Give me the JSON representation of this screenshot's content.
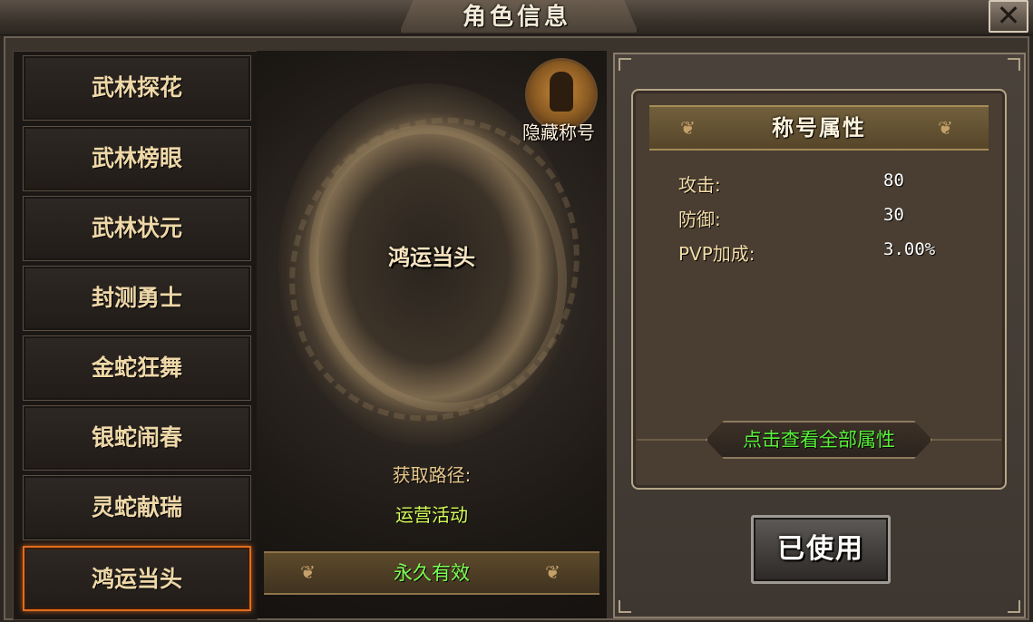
{
  "window": {
    "title": "角色信息",
    "close_glyph": "✕"
  },
  "title_list": {
    "items": [
      {
        "label": "武林探花",
        "selected": false
      },
      {
        "label": "武林榜眼",
        "selected": false
      },
      {
        "label": "武林状元",
        "selected": false
      },
      {
        "label": "封测勇士",
        "selected": false
      },
      {
        "label": "金蛇狂舞",
        "selected": false
      },
      {
        "label": "银蛇闹春",
        "selected": false
      },
      {
        "label": "灵蛇献瑞",
        "selected": false
      },
      {
        "label": "鸿运当头",
        "selected": true
      }
    ]
  },
  "preview": {
    "title_name": "鸿运当头",
    "hidden_title_label": "隐藏称号",
    "source_label": "获取路径:",
    "source_value": "运营活动",
    "validity": "永久有效"
  },
  "attributes": {
    "header": "称号属性",
    "rows": [
      {
        "name": "攻击:",
        "value": "80"
      },
      {
        "name": "防御:",
        "value": "30"
      },
      {
        "name": "PVP加成:",
        "value": "3.00%"
      }
    ],
    "view_all_label": "点击查看全部属性"
  },
  "actions": {
    "used_label": "已使用"
  },
  "colors": {
    "selected_border": "#e06d1e",
    "green_text": "#58f03a",
    "source_value": "#d7ff5a"
  }
}
